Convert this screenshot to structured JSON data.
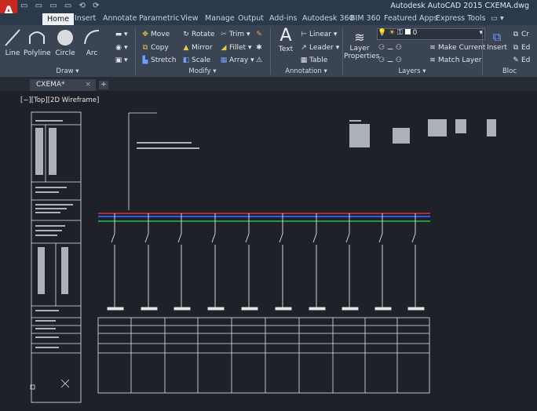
{
  "titlebar": {
    "app_icon": "A",
    "qat": "▭ ▭ ▭ ▭ ⟲ ⟳",
    "title": "Autodesk AutoCAD 2015    CXEMA.dwg"
  },
  "tabs": [
    "Home",
    "Insert",
    "Annotate",
    "Parametric",
    "View",
    "Manage",
    "Output",
    "Add-ins",
    "Autodesk 360",
    "BIM 360",
    "Featured Apps",
    "Express Tools"
  ],
  "ribbon": {
    "draw": {
      "line": "Line",
      "polyline": "Polyline",
      "circle": "Circle",
      "arc": "Arc",
      "panel": "Draw ▾"
    },
    "modify": {
      "move": "Move",
      "rotate": "Rotate",
      "trim": "Trim ▾",
      "copy": "Copy",
      "mirror": "Mirror",
      "fillet": "Fillet ▾",
      "stretch": "Stretch",
      "scale": "Scale",
      "array": "Array ▾",
      "panel": "Modify ▾"
    },
    "annotation": {
      "text": "Text",
      "linear": "Linear ▾",
      "leader": "Leader ▾",
      "table": "Table",
      "panel": "Annotation ▾"
    },
    "layers": {
      "layer_properties": "Layer Properties",
      "layer_value": "0",
      "make_current": "Make Current",
      "match_layer": "Match Layer",
      "panel": "Layers ▾"
    },
    "block": {
      "insert": "Insert",
      "create": "Cr",
      "edit": "Ed",
      "edit2": "Ed",
      "panel": "Bloc"
    }
  },
  "doc_tab": "CXEMA*",
  "doc_tab_close": "×",
  "new_tab": "+",
  "viewport_label": "[−][Top][2D Wireframe]",
  "colors": {
    "titlebar": "#2b3a4b",
    "ribbon": "#3b4452",
    "canvas": "#1e2128",
    "bus_red": "#e23030",
    "bus_blue": "#2f55ff",
    "bus_green": "#21c24a",
    "app_red": "#c8281e"
  }
}
